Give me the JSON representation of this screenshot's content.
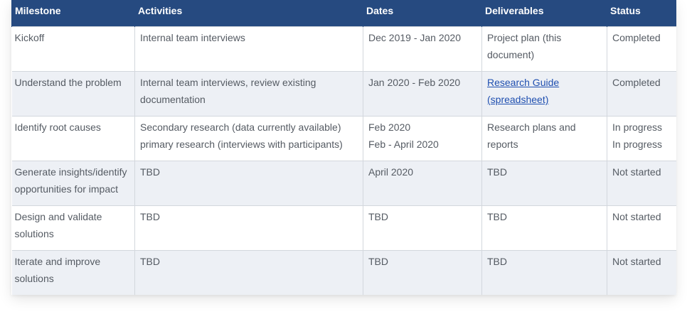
{
  "table": {
    "headers": [
      "Milestone",
      "Activities",
      "Dates",
      "Deliverables",
      "Status"
    ],
    "rows": [
      {
        "milestone": "Kickoff",
        "activities": [
          "Internal team interviews"
        ],
        "dates": [
          "Dec 2019 - Jan 2020"
        ],
        "deliverables": "Project plan (this document)",
        "deliverable_is_link": false,
        "status": [
          "Completed"
        ]
      },
      {
        "milestone": "Understand the problem",
        "activities": [
          "Internal team interviews, review existing documentation"
        ],
        "dates": [
          "Jan 2020 - Feb 2020"
        ],
        "deliverables": "Research Guide (spreadsheet)",
        "deliverable_is_link": true,
        "status": [
          "Completed"
        ]
      },
      {
        "milestone": "Identify root causes",
        "activities": [
          "Secondary research (data currently available)",
          "primary research (interviews with participants)"
        ],
        "dates": [
          "Feb 2020",
          "Feb - April 2020"
        ],
        "deliverables": "Research plans and reports",
        "deliverable_is_link": false,
        "status": [
          "In progress",
          "In progress"
        ]
      },
      {
        "milestone": "Generate insights/identify opportunities for impact",
        "activities": [
          "TBD"
        ],
        "dates": [
          "April 2020"
        ],
        "deliverables": "TBD",
        "deliverable_is_link": false,
        "status": [
          "Not started"
        ]
      },
      {
        "milestone": "Design and validate solutions",
        "activities": [
          "TBD"
        ],
        "dates": [
          "TBD"
        ],
        "deliverables": "TBD",
        "deliverable_is_link": false,
        "status": [
          "Not started"
        ]
      },
      {
        "milestone": "Iterate and improve solutions",
        "activities": [
          "TBD"
        ],
        "dates": [
          "TBD"
        ],
        "deliverables": "TBD",
        "deliverable_is_link": false,
        "status": [
          "Not started"
        ]
      }
    ]
  },
  "colors": {
    "header_bg": "#264a80",
    "header_text": "#ffffff",
    "row_alt_bg": "#edf0f5",
    "body_text": "#555b63",
    "link": "#1f4fb0"
  }
}
